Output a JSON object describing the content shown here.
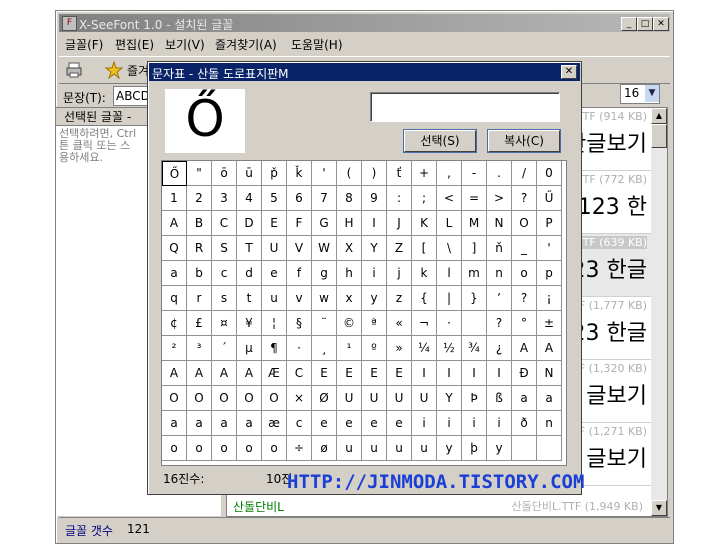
{
  "window": {
    "title": "X-SeeFont 1.0 - 설치된 글꼴",
    "app_icon": "F",
    "controls": [
      "_",
      "□",
      "✕"
    ]
  },
  "menu": [
    "글꼴(F)",
    "편집(E)",
    "보기(V)",
    "즐겨찾기(A)",
    "도움말(H)"
  ],
  "toolbar": {
    "favorites_label": "즐겨",
    "print_icon": "printer-icon",
    "star_icon": "star-icon"
  },
  "sentence": {
    "label": "문장(T):",
    "value": "ABCD"
  },
  "format": {
    "bold": "B",
    "italic": "I",
    "underline": "U",
    "size": "16"
  },
  "left_pane": {
    "header": "선택된 글꼴 -",
    "hint": "선택하려면, Ctrl\n튼 클릭 또는 스\n용하세요."
  },
  "font_rows": [
    {
      "meta": "TTF (914 KB)",
      "sample": "한글보기"
    },
    {
      "meta": "TTF (772 KB)",
      "sample": "Z 123 한"
    },
    {
      "meta": "TTF (639 KB)",
      "sample": "123 한글"
    },
    {
      "meta": "TTF (1,777 KB)",
      "sample": "123 한글"
    },
    {
      "meta": "TTF (1,320 KB)",
      "sample": "글보기"
    },
    {
      "meta": "TTF (1,271 KB)",
      "sample": "글보기"
    }
  ],
  "bottom_row": {
    "name": "산돌단비L",
    "meta": "산돌단비L.TTF (1,949 KB)"
  },
  "status": {
    "label": "글꼴 갯수",
    "count": "121"
  },
  "dialog": {
    "title": "문자표 - 산돌 도로표지판M",
    "preview_char": "Ő",
    "select_button": "선택(S)",
    "copy_button": "복사(C)",
    "hex_label": "16진수:",
    "dec_label": "10진",
    "chars": [
      "Ő",
      "\"",
      "ō",
      "ū",
      "p̌",
      "ǩ",
      "'",
      "(",
      ")",
      "ť",
      "+",
      ",",
      "-",
      ".",
      "/",
      "0",
      "1",
      "2",
      "3",
      "4",
      "5",
      "6",
      "7",
      "8",
      "9",
      ":",
      ";",
      "<",
      "=",
      ">",
      "?",
      "Ű",
      "A",
      "B",
      "C",
      "D",
      "E",
      "F",
      "G",
      "H",
      "I",
      "J",
      "K",
      "L",
      "M",
      "N",
      "O",
      "P",
      "Q",
      "R",
      "S",
      "T",
      "U",
      "V",
      "W",
      "X",
      "Y",
      "Z",
      "[",
      "\\",
      "]",
      "ň",
      "_",
      "'",
      "a",
      "b",
      "c",
      "d",
      "e",
      "f",
      "g",
      "h",
      "i",
      "j",
      "k",
      "l",
      "m",
      "n",
      "o",
      "p",
      "q",
      "r",
      "s",
      "t",
      "u",
      "v",
      "w",
      "x",
      "y",
      "z",
      "{",
      "|",
      "}",
      "ʼ",
      "?",
      "¡",
      "¢",
      "£",
      "¤",
      "¥",
      "¦",
      "§",
      "¨",
      "©",
      "ª",
      "«",
      "¬",
      "·",
      "",
      "?",
      "°",
      "±",
      "²",
      "³",
      "´",
      "µ",
      "¶",
      "·",
      "¸",
      "¹",
      "º",
      "»",
      "¼",
      "½",
      "¾",
      "¿",
      "A",
      "A",
      "A",
      "A",
      "A",
      "A",
      "Æ",
      "C",
      "E",
      "E",
      "E",
      "E",
      "I",
      "I",
      "I",
      "I",
      "Ð",
      "N",
      "O",
      "O",
      "O",
      "O",
      "O",
      "×",
      "Ø",
      "U",
      "U",
      "U",
      "U",
      "Y",
      "Þ",
      "ß",
      "a",
      "a",
      "a",
      "a",
      "a",
      "a",
      "æ",
      "c",
      "e",
      "e",
      "e",
      "e",
      "i",
      "i",
      "i",
      "i",
      "ð",
      "n",
      "o",
      "o",
      "o",
      "o",
      "o",
      "÷",
      "ø",
      "u",
      "u",
      "u",
      "u",
      "y",
      "þ",
      "y",
      "",
      ""
    ]
  },
  "watermark": "HTTP://JINMODA.TISTORY.COM"
}
